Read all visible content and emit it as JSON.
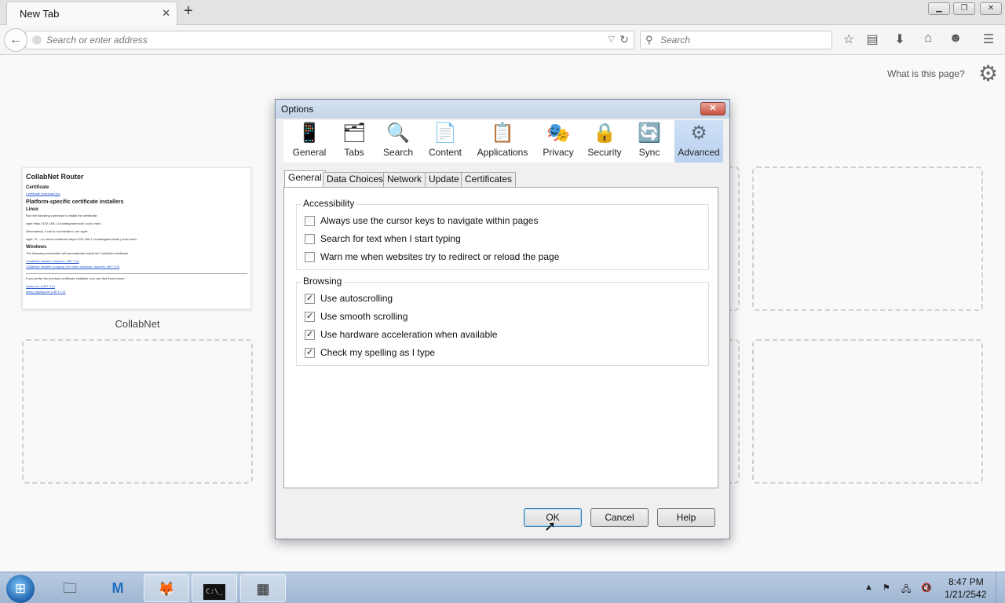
{
  "browser": {
    "tab_title": "New Tab",
    "url_placeholder": "Search or enter address",
    "search_placeholder": "Search"
  },
  "newtab_page": {
    "what_is_this": "What is this page?",
    "tile_label": "CollabNet",
    "thumbnail": {
      "title": "CollabNet Router",
      "certificate_heading": "Certificate",
      "certificate_link": "Certificate download (pr)",
      "installers_heading": "Platform-specific certificate installers",
      "linux_heading": "Linux",
      "linux_line1": "Run the following command to install the certificate:",
      "linux_cmd1": "wget https://192.168.1.1/collabgear/install | sudo bash -",
      "linux_line2": "Alternatively, if curl is not installed, use wget:",
      "linux_cmd2": "wget -O- --no-check-certificate https://192.168.1.1/collabgear/install | sudo bash -",
      "windows_heading": "Windows",
      "windows_line": "The following executable will automatically install the CollabNet certificate",
      "windows_link1": "CollabNet Installer (requires .NET 4.0)",
      "windows_link2": "CollabNet Installer (Legacy) (For older windows, requires .NET 2.0)",
      "prev_line": "If you prefer the previous certificate installers, you can find them below:",
      "prev_link1": "setup.exe (.NET 4.0)",
      "prev_link2": "setup_legacy.exe (.NET 2.0)"
    }
  },
  "dialog": {
    "title": "Options",
    "close_symbol": "✕",
    "panes": [
      {
        "label": "General",
        "icon": "phone-icon"
      },
      {
        "label": "Tabs",
        "icon": "folder-icon"
      },
      {
        "label": "Search",
        "icon": "magnifier-icon"
      },
      {
        "label": "Content",
        "icon": "content-icon"
      },
      {
        "label": "Applications",
        "icon": "applications-icon"
      },
      {
        "label": "Privacy",
        "icon": "mask-icon"
      },
      {
        "label": "Security",
        "icon": "lock-icon"
      },
      {
        "label": "Sync",
        "icon": "sync-icon"
      },
      {
        "label": "Advanced",
        "icon": "gear-icon"
      }
    ],
    "active_pane": "Advanced",
    "subtabs": [
      "General",
      "Data Choices",
      "Network",
      "Update",
      "Certificates"
    ],
    "active_subtab": "General",
    "accessibility": {
      "label": "Accessibility",
      "options": [
        {
          "label": "Always use the cursor keys to navigate within pages",
          "checked": false
        },
        {
          "label": "Search for text when I start typing",
          "checked": false
        },
        {
          "label": "Warn me when websites try to redirect or reload the page",
          "checked": false
        }
      ]
    },
    "browsing": {
      "label": "Browsing",
      "options": [
        {
          "label": "Use autoscrolling",
          "checked": true
        },
        {
          "label": "Use smooth scrolling",
          "checked": true
        },
        {
          "label": "Use hardware acceleration when available",
          "checked": true
        },
        {
          "label": "Check my spelling as I type",
          "checked": true
        }
      ]
    },
    "buttons": {
      "ok": "OK",
      "cancel": "Cancel",
      "help": "Help"
    }
  },
  "taskbar": {
    "time": "8:47 PM",
    "date": "1/21/2542"
  },
  "colors": {
    "dialog_title_bg": "#c3d4e7",
    "active_pane_bg": "#b8d1ef",
    "taskbar_bg": "#9fb6d2"
  }
}
